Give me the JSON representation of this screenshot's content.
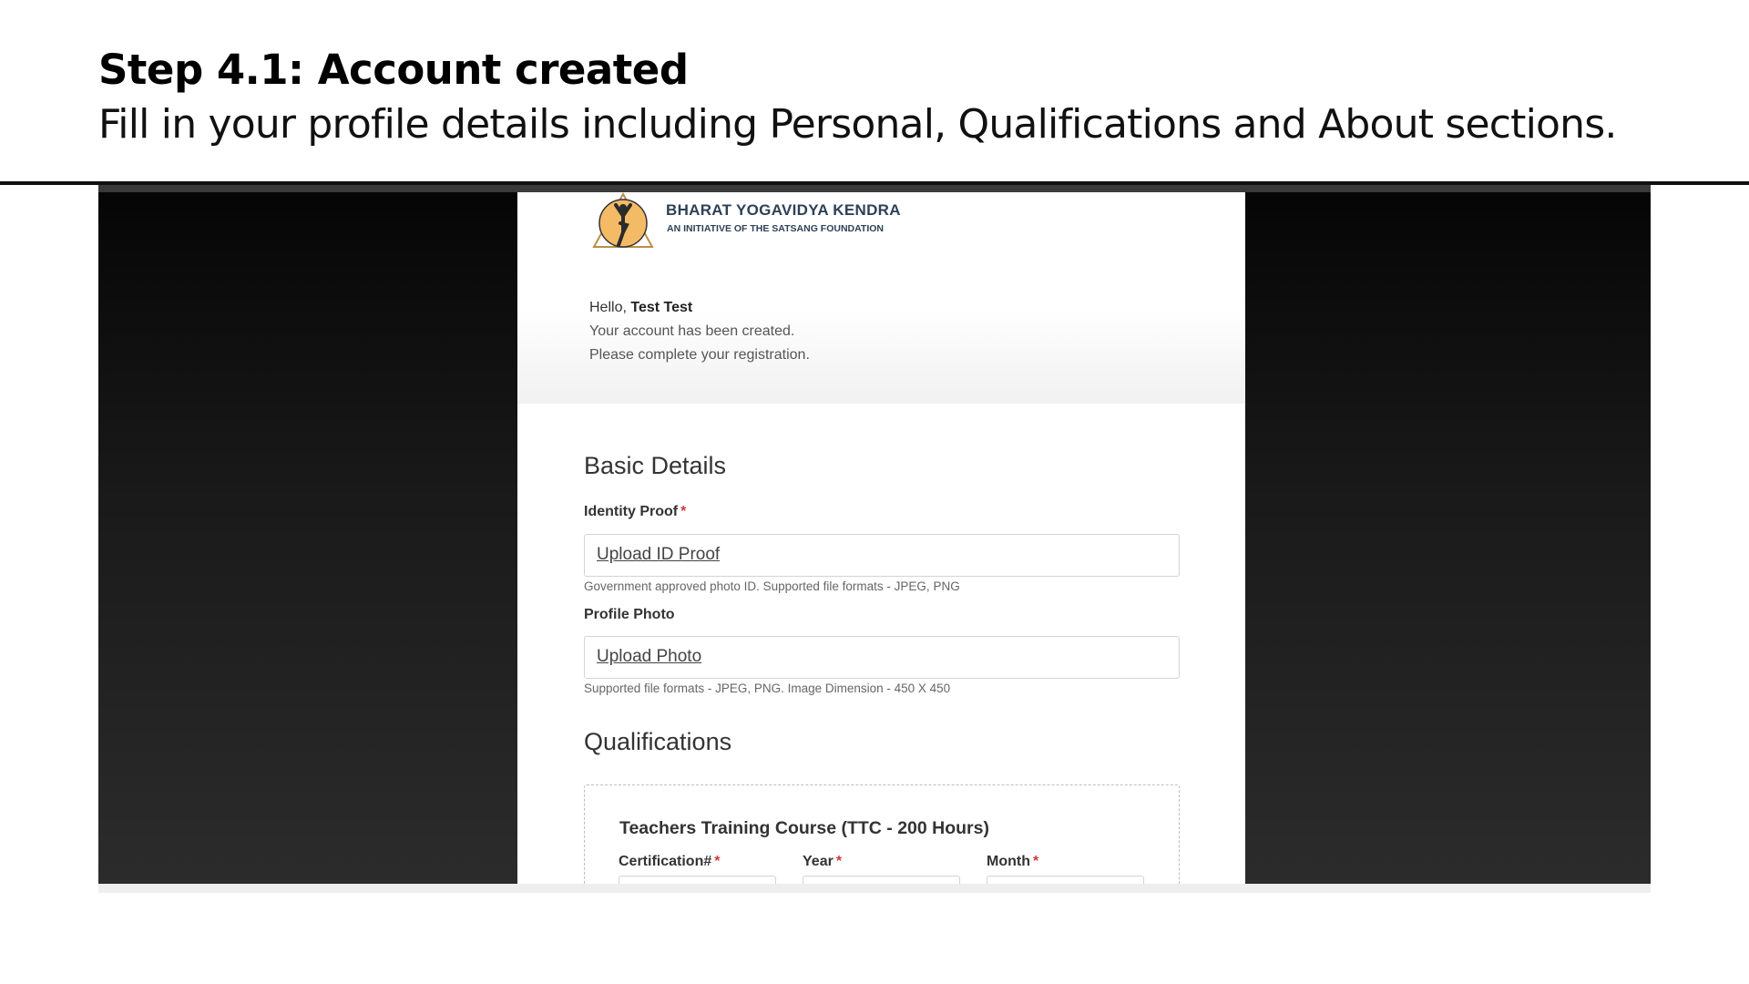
{
  "slide": {
    "title": "Step 4.1: Account created",
    "subtitle": "Fill in your profile details including Personal, Qualifications and About sections."
  },
  "org": {
    "name": "BHARAT YOGAVIDYA KENDRA",
    "tagline": "AN INITIATIVE OF THE SATSANG FOUNDATION",
    "logo_icon": "yoga-pose-logo-icon"
  },
  "greeting": {
    "hello": "Hello,",
    "user_name": "Test Test",
    "line1": "Your account has been created.",
    "line2": "Please complete your registration."
  },
  "basic_details": {
    "heading": "Basic Details",
    "identity_proof": {
      "label": "Identity Proof",
      "required_mark": "*",
      "upload_label": "Upload ID Proof",
      "help": "Government approved photo ID. Supported file formats - JPEG, PNG"
    },
    "profile_photo": {
      "label": "Profile Photo",
      "upload_label": "Upload Photo",
      "help": "Supported file formats - JPEG, PNG. Image Dimension - 450 X 450"
    }
  },
  "qualifications": {
    "heading": "Qualifications",
    "course_title": "Teachers Training Course (TTC - 200 Hours)",
    "columns": [
      {
        "label": "Certification#",
        "required_mark": "*"
      },
      {
        "label": "Year",
        "required_mark": "*"
      },
      {
        "label": "Month",
        "required_mark": "*"
      }
    ]
  },
  "colors": {
    "required": "#d03a3a",
    "org_text": "#2e4156",
    "logo_accent": "#f0b458"
  }
}
